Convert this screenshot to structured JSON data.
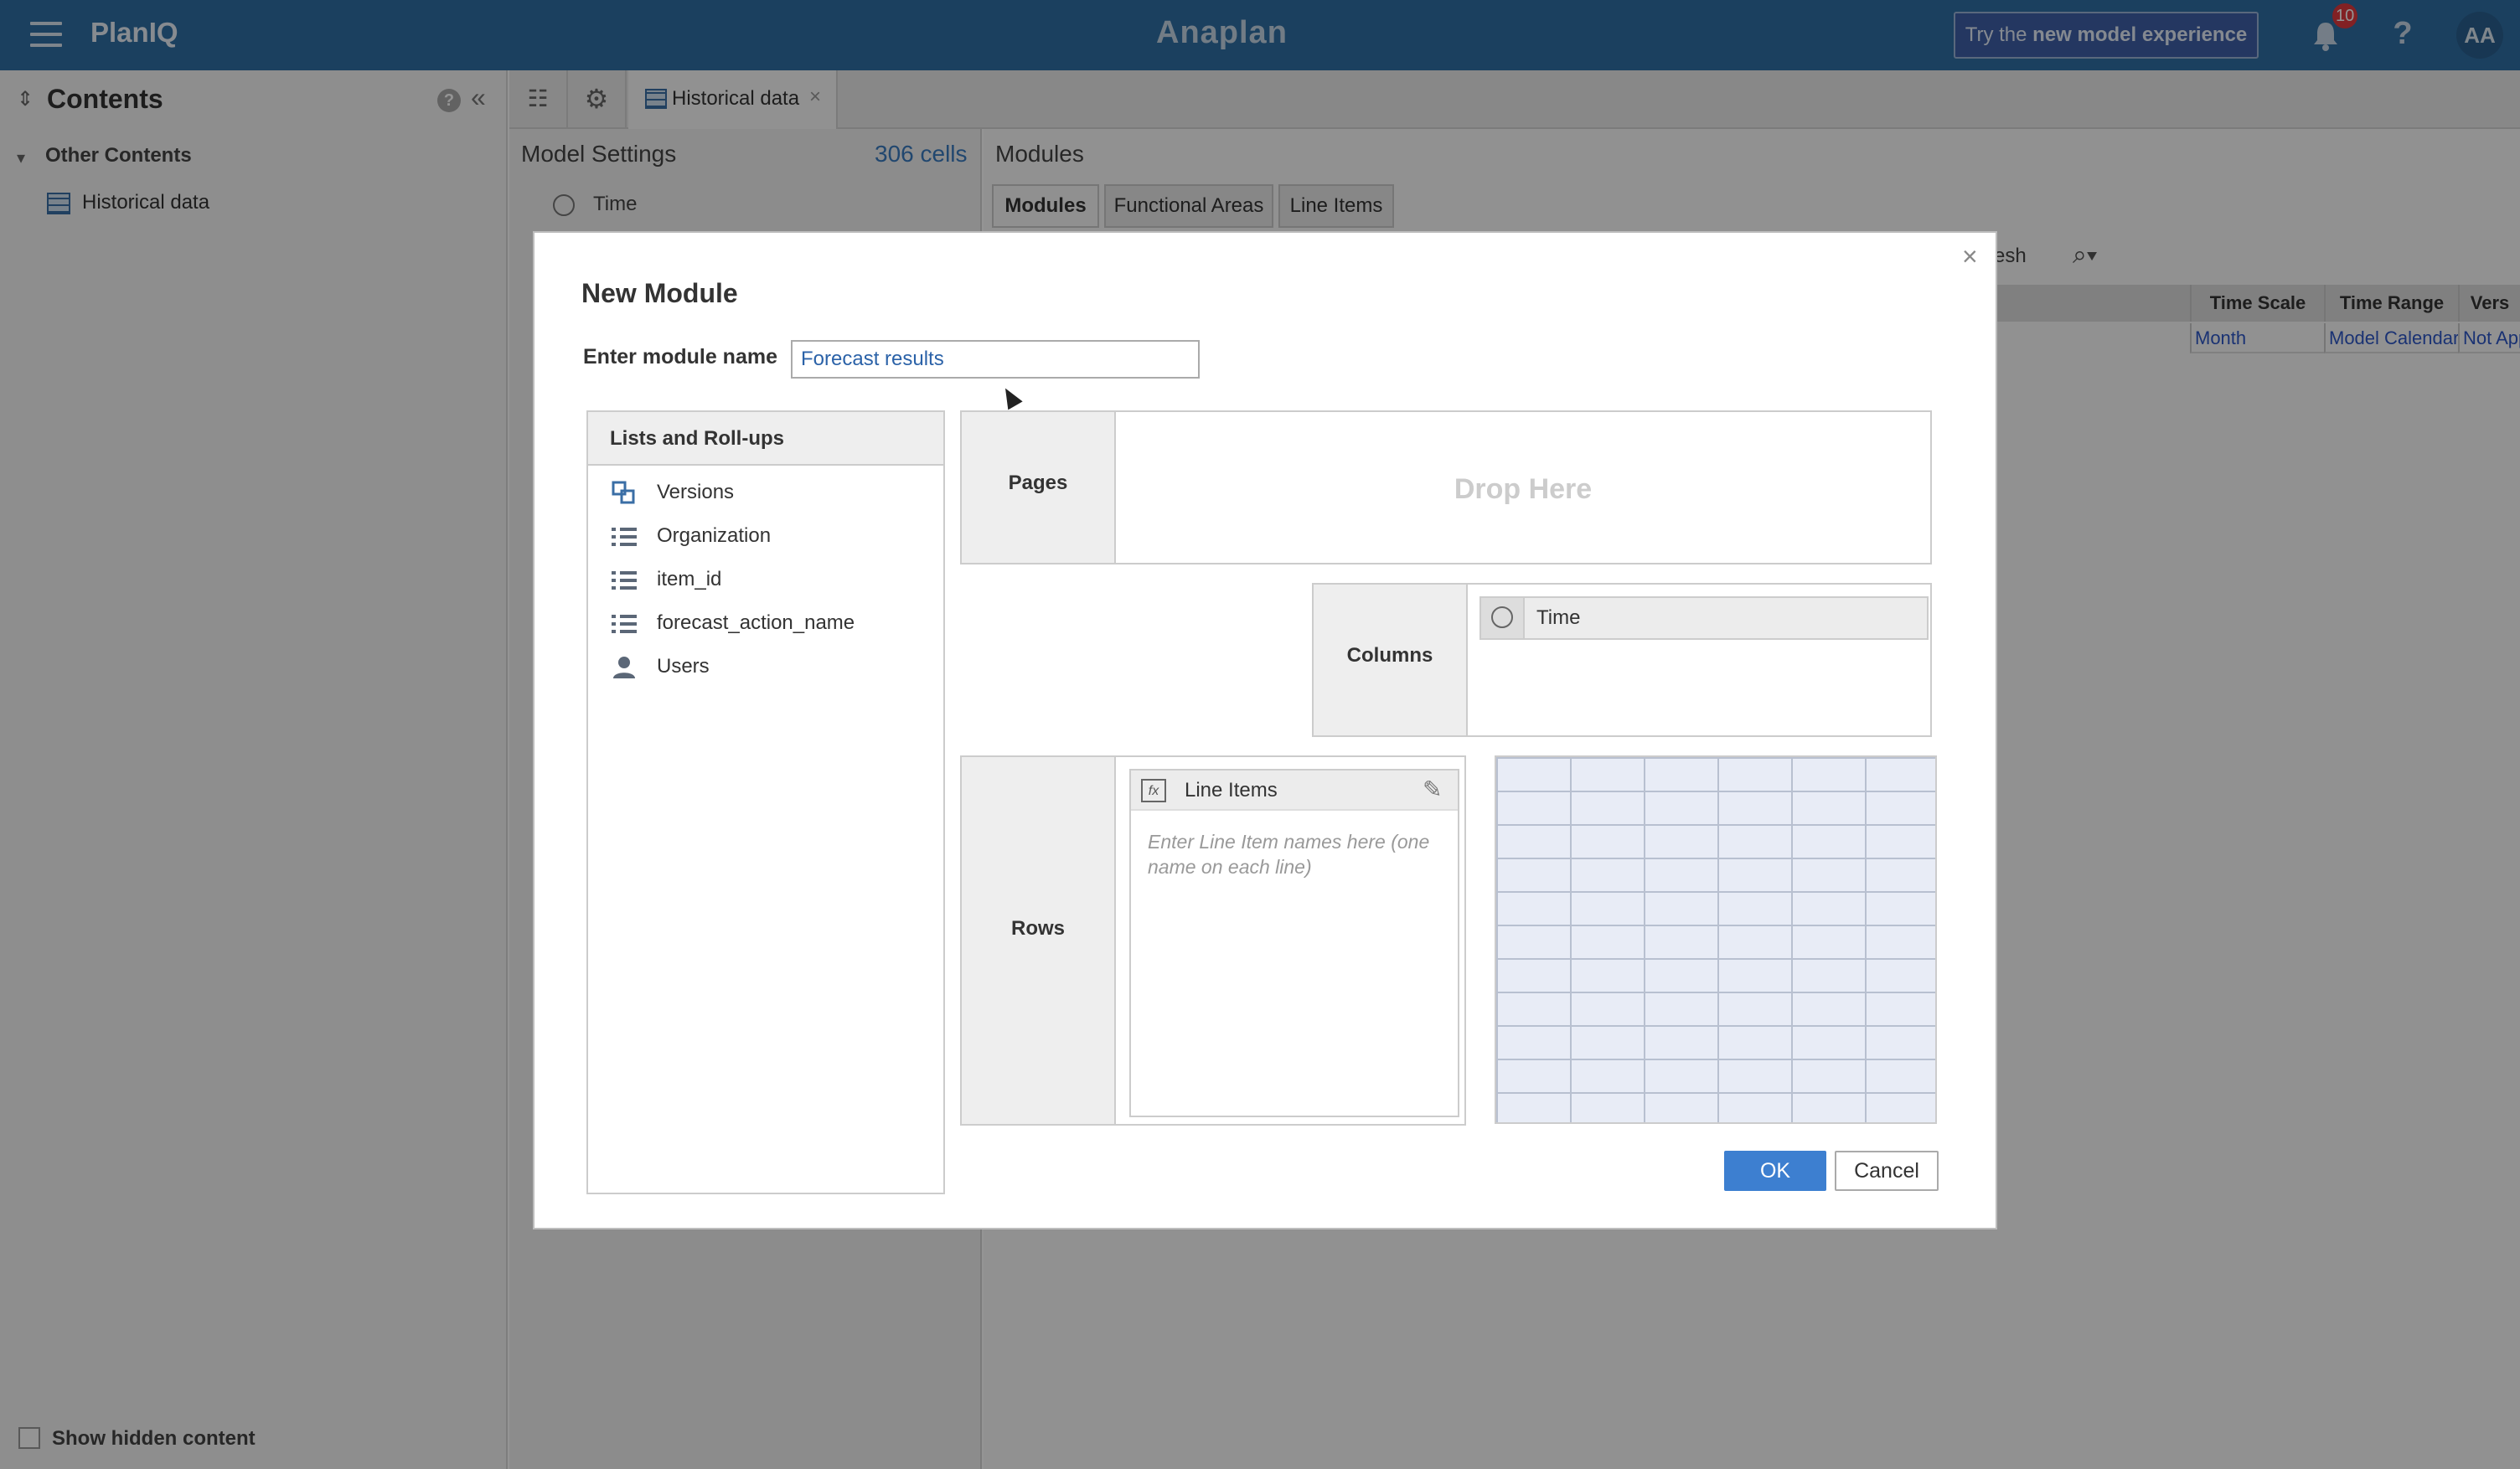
{
  "topbar": {
    "app_name": "PlanIQ",
    "brand": "Anaplan",
    "try_prefix": "Try the ",
    "try_bold": "new model experience",
    "notifications_count": "10",
    "help_glyph": "?",
    "avatar_initials": "AA"
  },
  "sidebar": {
    "title": "Contents",
    "help_glyph": "?",
    "collapse_glyph": "«",
    "section": "Other Contents",
    "item": "Historical data",
    "show_hidden": "Show hidden content"
  },
  "tabs": {
    "active_label": "Historical data",
    "close_glyph": "×"
  },
  "model_settings": {
    "title": "Model Settings",
    "cells": "306 cells",
    "time_label": "Time"
  },
  "modules_panel": {
    "title": "Modules",
    "subtabs": [
      "Modules",
      "Functional Areas",
      "Line Items"
    ],
    "refresh_fragment": "esh",
    "columns": [
      "Time Scale",
      "Time Range",
      "Vers"
    ],
    "row": [
      "Month",
      "Model Calendar",
      "Not App"
    ]
  },
  "dialog": {
    "close_glyph": "×",
    "title": "New Module",
    "name_label": "Enter module name",
    "name_value": "Forecast results",
    "lists_header": "Lists and Roll-ups",
    "lists": [
      {
        "label": "Versions",
        "icon": "versions-icon"
      },
      {
        "label": "Organization",
        "icon": "list-icon"
      },
      {
        "label": "item_id",
        "icon": "list-icon"
      },
      {
        "label": "forecast_action_name",
        "icon": "list-icon"
      },
      {
        "label": "Users",
        "icon": "user-icon"
      }
    ],
    "pages_label": "Pages",
    "drop_here": "Drop Here",
    "columns_label": "Columns",
    "columns_chip": "Time",
    "rows_label": "Rows",
    "line_items_label": "Line Items",
    "line_items_hint": "Enter Line Item names here (one name on each line)",
    "ok": "OK",
    "cancel": "Cancel"
  },
  "colors": {
    "topbar": "#2f6fa4",
    "accent": "#3d7fd0",
    "badge": "#e0393e"
  }
}
